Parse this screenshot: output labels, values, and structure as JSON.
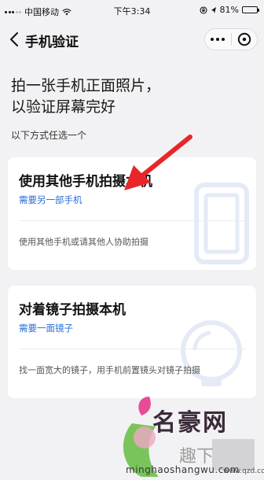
{
  "status_bar": {
    "carrier": "中国移动",
    "time": "下午3:34",
    "battery_percent": "81%",
    "battery_level": 0.81
  },
  "nav": {
    "title": "手机验证",
    "back_icon": "chevron-left-icon",
    "more_icon": "more-dots-icon",
    "close_icon": "close-circle-icon"
  },
  "headline": "拍一张手机正面照片，\n以验证屏幕完好",
  "hint": "以下方式任选一个",
  "options": [
    {
      "title": "使用其他手机拍摄本机",
      "link": "需要另一部手机",
      "desc": "使用其他手机或请其他人协助拍摄",
      "icon": "phone-outline-icon"
    },
    {
      "title": "对着镜子拍摄本机",
      "link": "需要一面镜子",
      "desc": "找一面宽大的镜子，用手机前置镜头对镜子拍摄",
      "icon": "mirror-outline-icon"
    }
  ],
  "watermark": {
    "brand": "名豪网",
    "sub": "趣下",
    "url": "minghaoshangwu.com",
    "url2": "www.qzd.com"
  },
  "colors": {
    "background": "#f2f2f4",
    "link": "#2a6fd6",
    "arrow": "#e8262a",
    "watermark_icon": "#e6ecf7"
  }
}
